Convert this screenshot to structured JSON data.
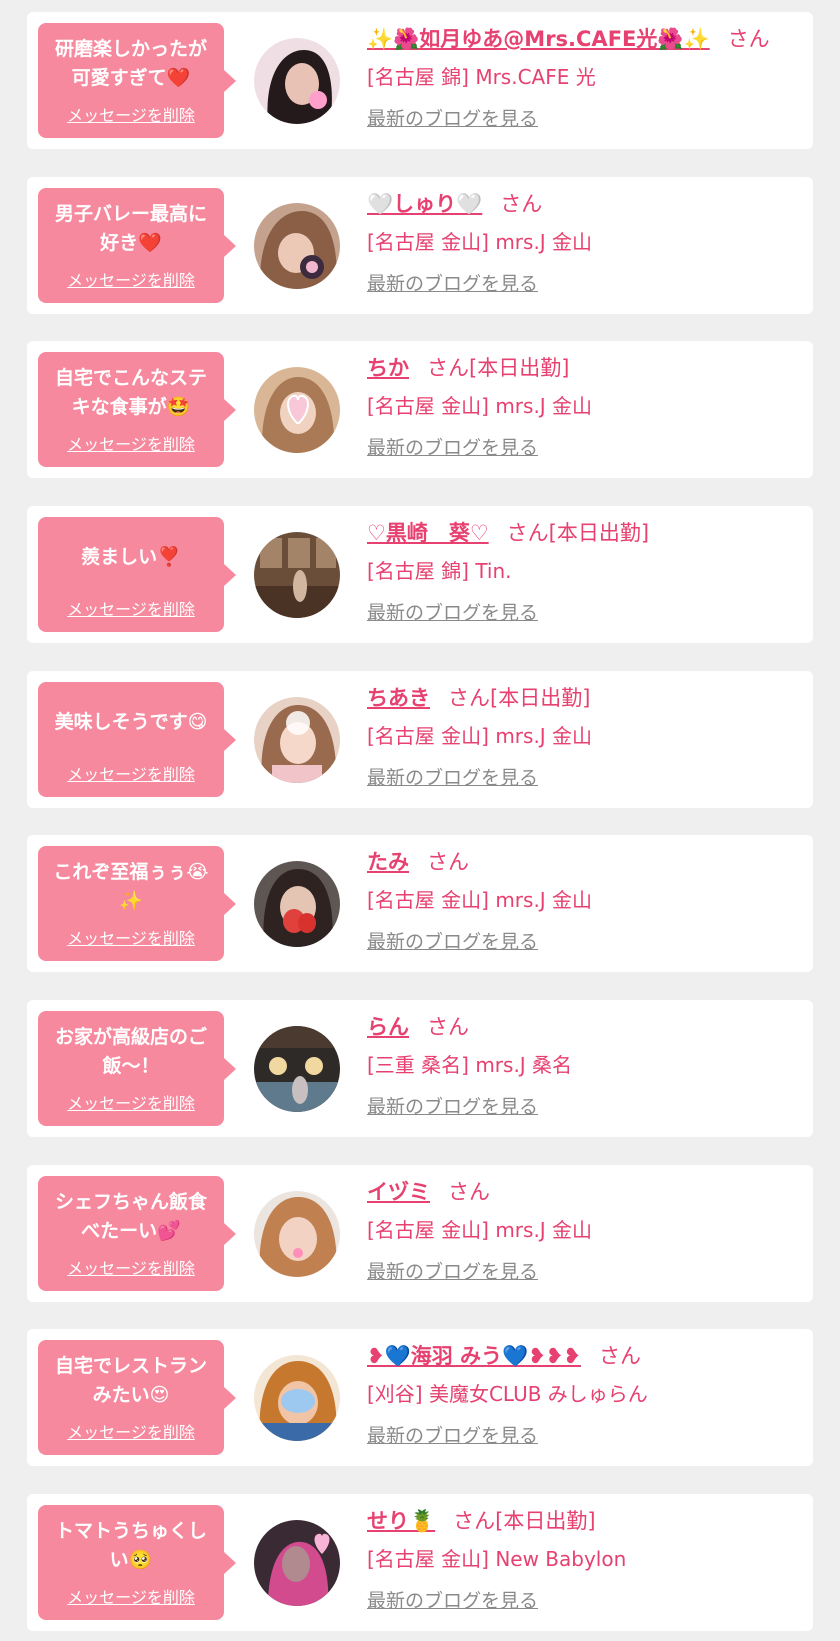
{
  "colors": {
    "background": "#efefef",
    "card": "#ffffff",
    "bubble": "#f6899e",
    "accent": "#e64170",
    "link_gray": "#8a8a8a"
  },
  "items": [
    {
      "message": "研磨楽しかったが可愛すぎて❤️",
      "delete_label": "メッセージを削除",
      "name": "✨🌺如月ゆあ@Mrs.CAFE光🌺✨",
      "suffix": "さん",
      "shop": "[名古屋 錦] Mrs.CAFE 光",
      "blog_label": "最新のブログを見る",
      "avatar_icon": "portrait-photo"
    },
    {
      "message": "男子バレー最高に好き❤️",
      "delete_label": "メッセージを削除",
      "name": "🤍しゅり🤍",
      "suffix": "さん",
      "shop": "[名古屋 金山] mrs.J 金山",
      "blog_label": "最新のブログを見る",
      "avatar_icon": "portrait-photo"
    },
    {
      "message": "自宅でこんなステキな食事が🤩",
      "delete_label": "メッセージを削除",
      "name": "ちか",
      "suffix": "さん[本日出勤]",
      "shop": "[名古屋 金山] mrs.J 金山",
      "blog_label": "最新のブログを見る",
      "avatar_icon": "portrait-photo"
    },
    {
      "message": "羨ましい❣️",
      "delete_label": "メッセージを削除",
      "name": "♡黒崎　葵♡",
      "suffix": "さん[本日出勤]",
      "shop": "[名古屋 錦] Tin.",
      "blog_label": "最新のブログを見る",
      "avatar_icon": "portrait-photo"
    },
    {
      "message": "美味しそうです😋",
      "delete_label": "メッセージを削除",
      "name": "ちあき",
      "suffix": "さん[本日出勤]",
      "shop": "[名古屋 金山] mrs.J 金山",
      "blog_label": "最新のブログを見る",
      "avatar_icon": "portrait-photo"
    },
    {
      "message": "これぞ至福ぅぅ😭✨",
      "delete_label": "メッセージを削除",
      "name": "たみ",
      "suffix": "さん",
      "shop": "[名古屋 金山] mrs.J 金山",
      "blog_label": "最新のブログを見る",
      "avatar_icon": "portrait-photo"
    },
    {
      "message": "お家が高級店のご飯〜！",
      "delete_label": "メッセージを削除",
      "name": "らん",
      "suffix": "さん",
      "shop": "[三重 桑名] mrs.J 桑名",
      "blog_label": "最新のブログを見る",
      "avatar_icon": "portrait-photo"
    },
    {
      "message": "シェフちゃん飯食べたーい💕",
      "delete_label": "メッセージを削除",
      "name": "イヅミ",
      "suffix": "さん",
      "shop": "[名古屋 金山] mrs.J 金山",
      "blog_label": "最新のブログを見る",
      "avatar_icon": "portrait-photo"
    },
    {
      "message": "自宅でレストランみたい😍",
      "delete_label": "メッセージを削除",
      "name": "❥💙海羽 みう💙❥❥❥",
      "suffix": "さん",
      "shop": "[刈谷] 美魔女CLUB みしゅらん",
      "blog_label": "最新のブログを見る",
      "avatar_icon": "portrait-photo"
    },
    {
      "message": "トマトうちゅくしい🥺",
      "delete_label": "メッセージを削除",
      "name": "せり🍍",
      "suffix": "さん[本日出勤]",
      "shop": "[名古屋 金山] New Babylon",
      "blog_label": "最新のブログを見る",
      "avatar_icon": "portrait-photo"
    }
  ]
}
